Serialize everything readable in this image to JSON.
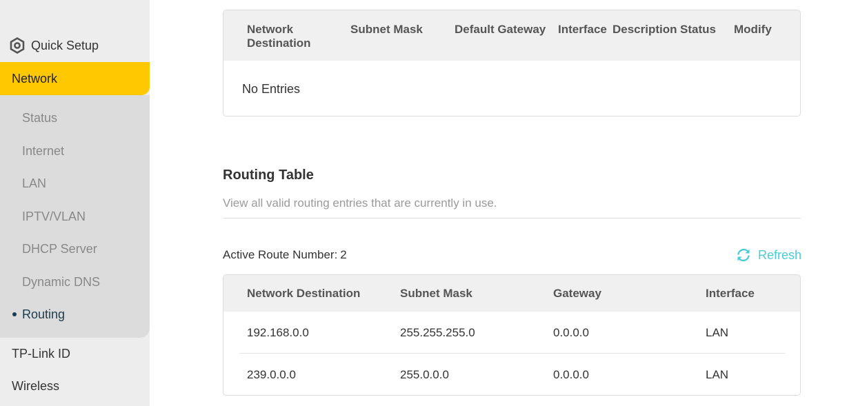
{
  "sidebar": {
    "quick_setup": "Quick Setup",
    "network": "Network",
    "sub_items": [
      "Status",
      "Internet",
      "LAN",
      "IPTV/VLAN",
      "DHCP Server",
      "Dynamic DNS",
      "Routing"
    ],
    "tplink_id": "TP-Link ID",
    "wireless": "Wireless",
    "accent_color": "#ffc800"
  },
  "static_routing": {
    "headers": [
      "Network Destination",
      "Subnet Mask",
      "Default Gateway",
      "Interface",
      "Description",
      "Status",
      "Modify"
    ],
    "empty_text": "No Entries"
  },
  "routing_table": {
    "title": "Routing Table",
    "description": "View all valid routing entries that are currently in use.",
    "active_label": "Active Route Number:",
    "active_count": "2",
    "refresh_label": "Refresh",
    "headers": [
      "Network Destination",
      "Subnet Mask",
      "Gateway",
      "Interface"
    ],
    "rows": [
      [
        "192.168.0.0",
        "255.255.255.0",
        "0.0.0.0",
        "LAN"
      ],
      [
        "239.0.0.0",
        "255.0.0.0",
        "0.0.0.0",
        "LAN"
      ]
    ],
    "accent_color": "#4acbd6"
  }
}
